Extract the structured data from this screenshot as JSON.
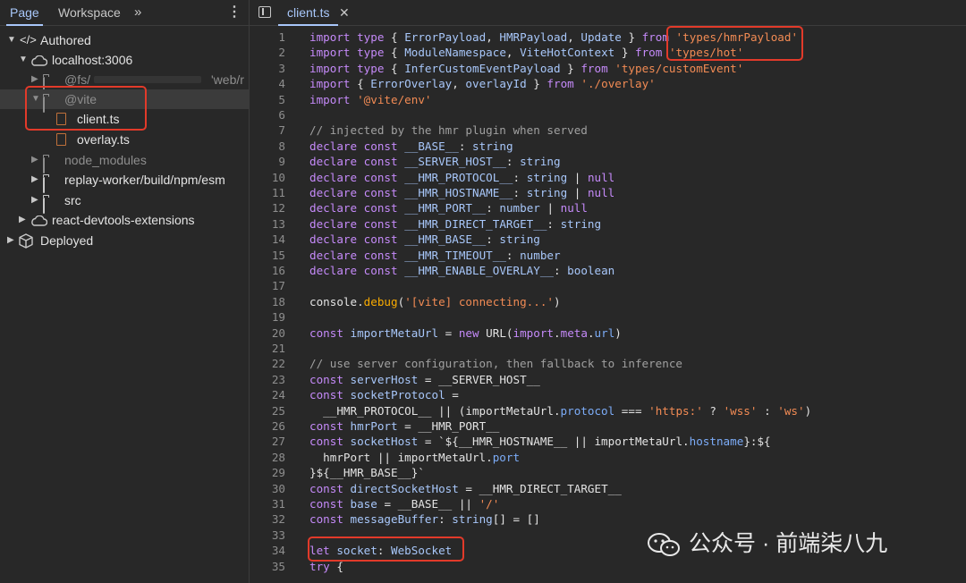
{
  "left_panel": {
    "tabs": [
      "Page",
      "Workspace"
    ],
    "more_tabs": "»",
    "menu": "⋮",
    "tree": [
      {
        "label": "Authored"
      },
      {
        "label": "localhost:3006"
      },
      {
        "label": "@fs/",
        "suffix": "'web/r"
      },
      {
        "label": "@vite"
      },
      {
        "label": "client.ts"
      },
      {
        "label": "overlay.ts"
      },
      {
        "label": "node_modules"
      },
      {
        "label": "replay-worker/build/npm/esm"
      },
      {
        "label": "src"
      },
      {
        "label": "react-devtools-extensions"
      },
      {
        "label": "Deployed"
      }
    ]
  },
  "editor": {
    "tab_label": "client.ts",
    "close": "✕",
    "lines": [
      {
        "n": "1",
        "t": [
          [
            "import",
            "kw"
          ],
          " ",
          [
            "type",
            "kw"
          ],
          " { ",
          [
            "ErrorPayload",
            "typ"
          ],
          ", ",
          [
            "HMRPayload",
            "typ"
          ],
          ", ",
          [
            "Update",
            "typ"
          ],
          " } ",
          [
            "from",
            "kw"
          ],
          " ",
          [
            "'types/hmrPayload'",
            "str"
          ]
        ]
      },
      {
        "n": "2",
        "t": [
          [
            "import",
            "kw"
          ],
          " ",
          [
            "type",
            "kw"
          ],
          " { ",
          [
            "ModuleNamespace",
            "typ"
          ],
          ", ",
          [
            "ViteHotContext",
            "typ"
          ],
          " } ",
          [
            "from",
            "kw"
          ],
          " ",
          [
            "'types/hot'",
            "str"
          ]
        ]
      },
      {
        "n": "3",
        "t": [
          [
            "import",
            "kw"
          ],
          " ",
          [
            "type",
            "kw"
          ],
          " { ",
          [
            "InferCustomEventPayload",
            "typ"
          ],
          " } ",
          [
            "from",
            "kw"
          ],
          " ",
          [
            "'types/customEvent'",
            "str"
          ]
        ]
      },
      {
        "n": "4",
        "t": [
          [
            "import",
            "kw"
          ],
          " { ",
          [
            "ErrorOverlay",
            "typ"
          ],
          ", ",
          [
            "overlayId",
            "typ"
          ],
          " } ",
          [
            "from",
            "kw"
          ],
          " ",
          [
            "'./overlay'",
            "str"
          ]
        ]
      },
      {
        "n": "5",
        "t": [
          [
            "import",
            "kw"
          ],
          " ",
          [
            "'@vite/env'",
            "str"
          ]
        ]
      },
      {
        "n": "6",
        "t": []
      },
      {
        "n": "7",
        "t": [
          [
            "// injected by the hmr plugin when served",
            "cmt"
          ]
        ]
      },
      {
        "n": "8",
        "t": [
          [
            "declare",
            "kw"
          ],
          " ",
          [
            "const",
            "kw"
          ],
          " ",
          [
            "__BASE__",
            "typ"
          ],
          ": ",
          [
            "string",
            "typ"
          ]
        ]
      },
      {
        "n": "9",
        "t": [
          [
            "declare",
            "kw"
          ],
          " ",
          [
            "const",
            "kw"
          ],
          " ",
          [
            "__SERVER_HOST__",
            "typ"
          ],
          ": ",
          [
            "string",
            "typ"
          ]
        ]
      },
      {
        "n": "10",
        "t": [
          [
            "declare",
            "kw"
          ],
          " ",
          [
            "const",
            "kw"
          ],
          " ",
          [
            "__HMR_PROTOCOL__",
            "typ"
          ],
          ": ",
          [
            "string",
            "typ"
          ],
          " | ",
          [
            "null",
            "kw"
          ]
        ]
      },
      {
        "n": "11",
        "t": [
          [
            "declare",
            "kw"
          ],
          " ",
          [
            "const",
            "kw"
          ],
          " ",
          [
            "__HMR_HOSTNAME__",
            "typ"
          ],
          ": ",
          [
            "string",
            "typ"
          ],
          " | ",
          [
            "null",
            "kw"
          ]
        ]
      },
      {
        "n": "12",
        "t": [
          [
            "declare",
            "kw"
          ],
          " ",
          [
            "const",
            "kw"
          ],
          " ",
          [
            "__HMR_PORT__",
            "typ"
          ],
          ": ",
          [
            "number",
            "typ"
          ],
          " | ",
          [
            "null",
            "kw"
          ]
        ]
      },
      {
        "n": "13",
        "t": [
          [
            "declare",
            "kw"
          ],
          " ",
          [
            "const",
            "kw"
          ],
          " ",
          [
            "__HMR_DIRECT_TARGET__",
            "typ"
          ],
          ": ",
          [
            "string",
            "typ"
          ]
        ]
      },
      {
        "n": "14",
        "t": [
          [
            "declare",
            "kw"
          ],
          " ",
          [
            "const",
            "kw"
          ],
          " ",
          [
            "__HMR_BASE__",
            "typ"
          ],
          ": ",
          [
            "string",
            "typ"
          ]
        ]
      },
      {
        "n": "15",
        "t": [
          [
            "declare",
            "kw"
          ],
          " ",
          [
            "const",
            "kw"
          ],
          " ",
          [
            "__HMR_TIMEOUT__",
            "typ"
          ],
          ": ",
          [
            "number",
            "typ"
          ]
        ]
      },
      {
        "n": "16",
        "t": [
          [
            "declare",
            "kw"
          ],
          " ",
          [
            "const",
            "kw"
          ],
          " ",
          [
            "__HMR_ENABLE_OVERLAY__",
            "typ"
          ],
          ": ",
          [
            "boolean",
            "typ"
          ]
        ]
      },
      {
        "n": "17",
        "t": []
      },
      {
        "n": "18",
        "t": [
          "console.",
          [
            "debug",
            "fn"
          ],
          "(",
          [
            "'[vite] connecting...'",
            "str"
          ],
          ")"
        ]
      },
      {
        "n": "19",
        "t": []
      },
      {
        "n": "20",
        "t": [
          [
            "const",
            "kw"
          ],
          " ",
          [
            "importMetaUrl",
            "typ"
          ],
          " = ",
          [
            "new",
            "kw"
          ],
          " URL(",
          [
            "import",
            "kw"
          ],
          ".",
          [
            "meta",
            "kw"
          ],
          ".",
          [
            "url",
            "prop"
          ],
          ")"
        ]
      },
      {
        "n": "21",
        "t": []
      },
      {
        "n": "22",
        "t": [
          [
            "// use server configuration, then fallback to inference",
            "cmt"
          ]
        ]
      },
      {
        "n": "23",
        "t": [
          [
            "const",
            "kw"
          ],
          " ",
          [
            "serverHost",
            "typ"
          ],
          " = __SERVER_HOST__"
        ]
      },
      {
        "n": "24",
        "t": [
          [
            "const",
            "kw"
          ],
          " ",
          [
            "socketProtocol",
            "typ"
          ],
          " ="
        ]
      },
      {
        "n": "25",
        "t": [
          "  __HMR_PROTOCOL__ || (importMetaUrl.",
          [
            "protocol",
            "prop"
          ],
          " === ",
          [
            "'https:'",
            "str"
          ],
          " ? ",
          [
            "'wss'",
            "str"
          ],
          " : ",
          [
            "'ws'",
            "str"
          ],
          ")"
        ]
      },
      {
        "n": "26",
        "t": [
          [
            "const",
            "kw"
          ],
          " ",
          [
            "hmrPort",
            "typ"
          ],
          " = __HMR_PORT__"
        ]
      },
      {
        "n": "27",
        "t": [
          [
            "const",
            "kw"
          ],
          " ",
          [
            "socketHost",
            "typ"
          ],
          " = `${__HMR_HOSTNAME__ || importMetaUrl.",
          [
            "hostname",
            "prop"
          ],
          "}:${"
        ]
      },
      {
        "n": "28",
        "t": [
          "  hmrPort || importMetaUrl.",
          [
            "port",
            "prop"
          ]
        ]
      },
      {
        "n": "29",
        "t": [
          "}${__HMR_BASE__}`"
        ]
      },
      {
        "n": "30",
        "t": [
          [
            "const",
            "kw"
          ],
          " ",
          [
            "directSocketHost",
            "typ"
          ],
          " = __HMR_DIRECT_TARGET__"
        ]
      },
      {
        "n": "31",
        "t": [
          [
            "const",
            "kw"
          ],
          " ",
          [
            "base",
            "typ"
          ],
          " = __BASE__ || ",
          [
            "'/'",
            "str"
          ]
        ]
      },
      {
        "n": "32",
        "t": [
          [
            "const",
            "kw"
          ],
          " ",
          [
            "messageBuffer",
            "typ"
          ],
          ": ",
          [
            "string",
            "typ"
          ],
          "[] = []"
        ]
      },
      {
        "n": "33",
        "t": []
      },
      {
        "n": "34",
        "t": [
          [
            "let",
            "kw"
          ],
          " ",
          [
            "socket",
            "typ"
          ],
          ": ",
          [
            "WebSocket",
            "typ"
          ]
        ]
      },
      {
        "n": "35",
        "t": [
          [
            "try",
            "kw"
          ],
          " {"
        ]
      }
    ]
  },
  "watermark": {
    "text": "公众号 · 前端柒八九"
  },
  "colors": {
    "highlight_box": "#e23a2a",
    "accent": "#a8c7fa",
    "background": "#282828"
  }
}
